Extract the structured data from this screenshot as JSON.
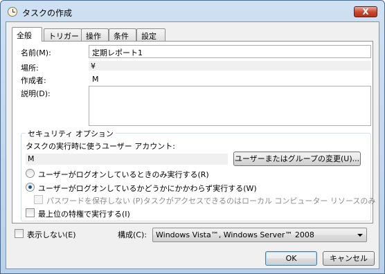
{
  "window": {
    "title": "タスクの作成",
    "close_glyph": "X"
  },
  "tabs": [
    {
      "label": "全般"
    },
    {
      "label": "トリガー"
    },
    {
      "label": "操作"
    },
    {
      "label": "条件"
    },
    {
      "label": "設定"
    }
  ],
  "general": {
    "name_label": "名前(M):",
    "name_value": "定期レポート1",
    "location_label": "場所:",
    "location_value": "¥",
    "author_label": "作成者:",
    "author_value": "M",
    "description_label": "説明(D):",
    "description_value": ""
  },
  "security": {
    "title": "セキュリティ オプション",
    "account_label": "タスクの実行時に使うユーザー アカウント:",
    "account_value": "M",
    "change_button": "ユーザーまたはグループの変更(U)...",
    "radio_logged_on": "ユーザーがログオンしているときのみ実行する(R)",
    "radio_whether": "ユーザーがログオンしているかどうかにかかわらず実行する(W)",
    "no_store_password": "パスワードを保存しない (P)タスクがアクセスできるのはローカル コンピューター リソースのみ",
    "highest_privileges": "最上位の特権で実行する(I)"
  },
  "bottom": {
    "hidden_label": "表示しない(E)",
    "configure_label": "構成(C):",
    "configure_value": "Windows Vista™, Windows Server™ 2008",
    "ok_button": "OK",
    "cancel_button": "キャンセル"
  }
}
